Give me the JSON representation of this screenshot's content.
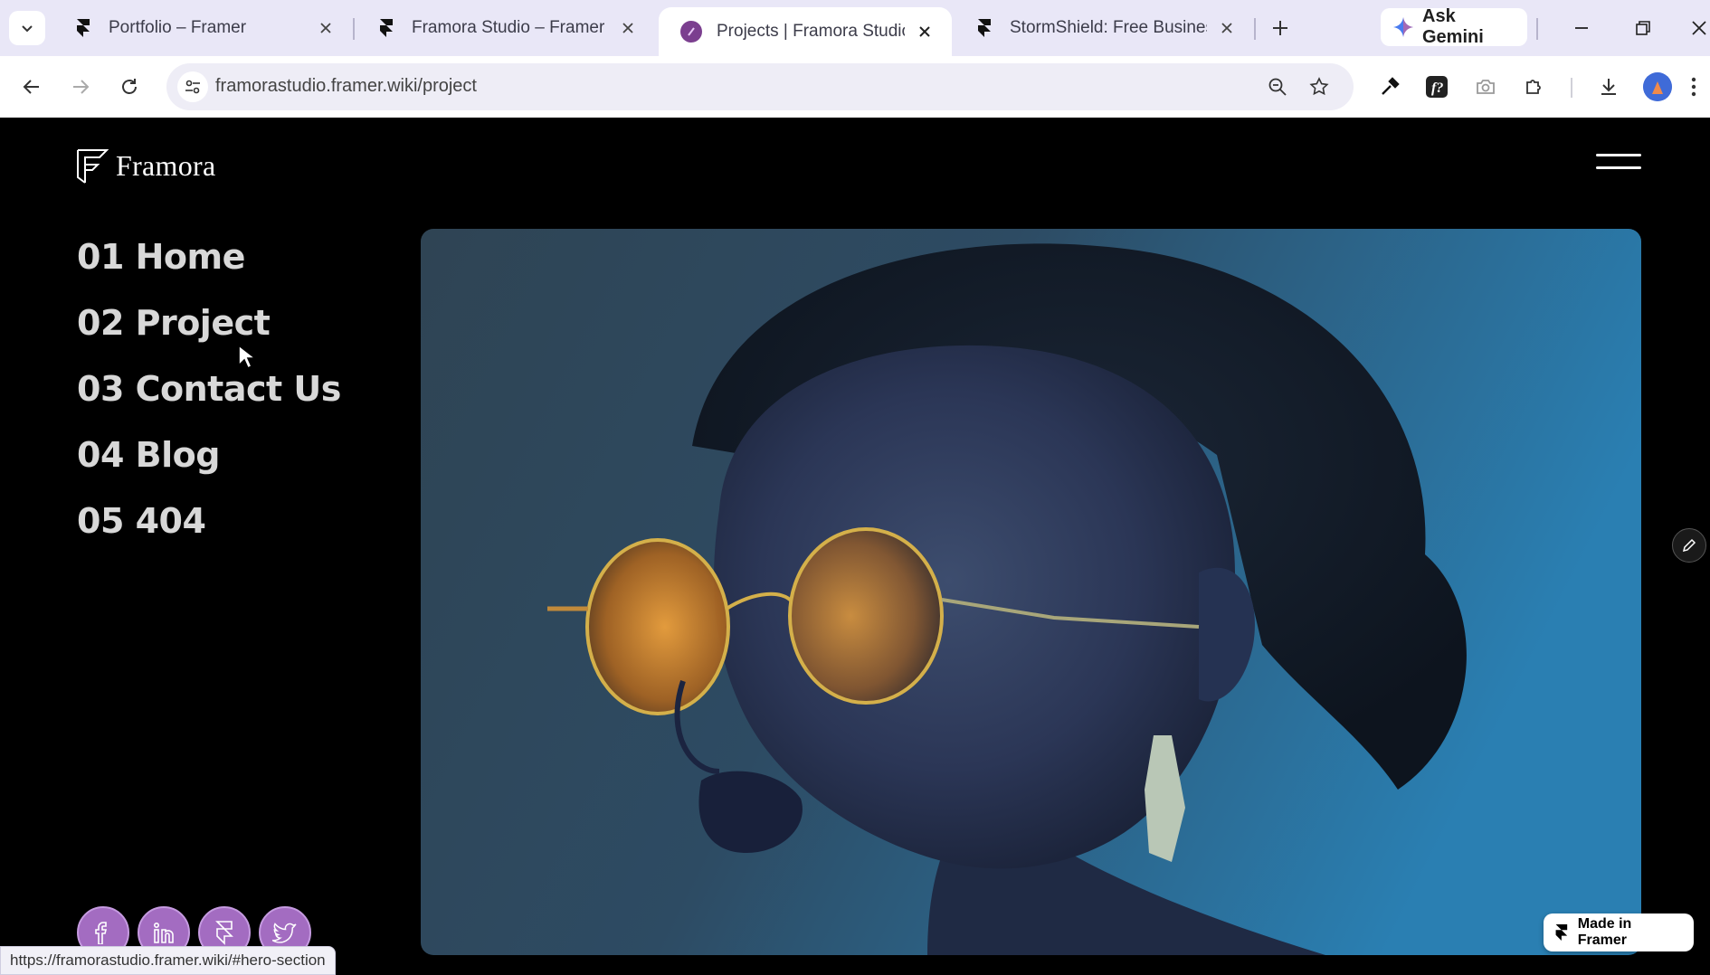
{
  "browser": {
    "tabs": [
      {
        "title": "Portfolio – Framer",
        "active": false
      },
      {
        "title": "Framora Studio – Framer",
        "active": false
      },
      {
        "title": "Projects | Framora Studio Po",
        "active": true
      },
      {
        "title": "StormShield: Free Business B",
        "active": false
      }
    ],
    "ask_gemini": "Ask Gemini",
    "url": "framorastudio.framer.wiki/project",
    "status_url": "https://framorastudio.framer.wiki/#hero-section"
  },
  "site": {
    "brand": "Framora",
    "menu": [
      {
        "label": "01 Home"
      },
      {
        "label": "02 Project"
      },
      {
        "label": "03 Contact Us"
      },
      {
        "label": "04 Blog"
      },
      {
        "label": "05 404"
      }
    ],
    "socials": [
      "facebook-icon",
      "linkedin-icon",
      "framer-icon",
      "twitter-icon"
    ],
    "made_in_framer": "Made in Framer"
  },
  "colors": {
    "tab_strip": "#e9e7f7",
    "social_bg": "#a36cc1",
    "page_bg": "#000000"
  }
}
